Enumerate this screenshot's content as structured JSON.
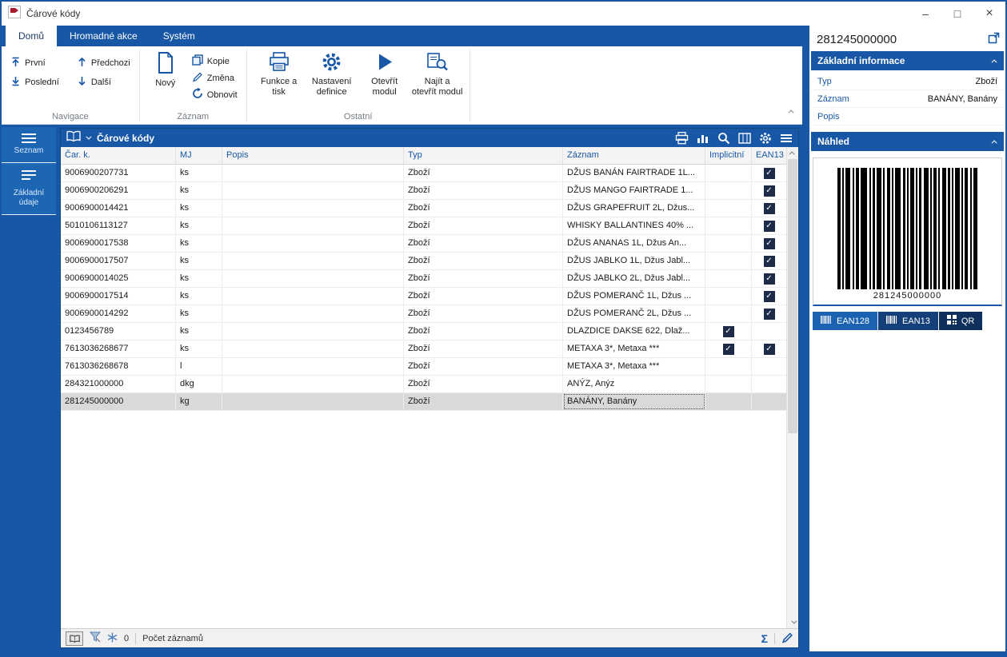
{
  "window": {
    "title": "Čárové kódy",
    "controls": {
      "minimize": "–",
      "maximize": "□",
      "close": "×"
    }
  },
  "tabs": [
    {
      "label": "Domů",
      "active": true
    },
    {
      "label": "Hromadné akce",
      "active": false
    },
    {
      "label": "Systém",
      "active": false
    }
  ],
  "ribbon": {
    "navigace": {
      "label": "Navigace",
      "prvni": "První",
      "posledni": "Poslední",
      "predchozi": "Předchozi",
      "dalsi": "Další"
    },
    "zaznam": {
      "label": "Záznam",
      "novy": "Nový",
      "kopie": "Kopie",
      "zmena": "Změna",
      "obnovit": "Obnovit"
    },
    "ostatni": {
      "label": "Ostatní",
      "funkce_tisk": "Funkce a tisk",
      "nastaveni_definice": "Nastavení definice",
      "otevrit_modul": "Otevřít modul",
      "najit_otevrit": "Najít a otevřít modul"
    }
  },
  "sidebar": {
    "items": [
      {
        "label": "Seznam"
      },
      {
        "label": "Základní údaje"
      }
    ]
  },
  "grid": {
    "title": "Čárové kódy",
    "columns": [
      "Čar. k.",
      "MJ",
      "Popis",
      "Typ",
      "Záznam",
      "Implicitní",
      "EAN13"
    ],
    "selected_index": 13,
    "rows": [
      {
        "code": "9006900207731",
        "mj": "ks",
        "popis": "",
        "typ": "Zboží",
        "zaznam": "DŽUS BANÁN FAIRTRADE 1L...",
        "implicitni": false,
        "ean13": true
      },
      {
        "code": "9006900206291",
        "mj": "ks",
        "popis": "",
        "typ": "Zboží",
        "zaznam": "DŽUS MANGO FAIRTRADE 1...",
        "implicitni": false,
        "ean13": true
      },
      {
        "code": "9006900014421",
        "mj": "ks",
        "popis": "",
        "typ": "Zboží",
        "zaznam": "DŽUS GRAPEFRUIT 2L, Džus...",
        "implicitni": false,
        "ean13": true
      },
      {
        "code": "5010106113127",
        "mj": "ks",
        "popis": "",
        "typ": "Zboží",
        "zaznam": "WHISKY BALLANTINES 40% ...",
        "implicitni": false,
        "ean13": true
      },
      {
        "code": "9006900017538",
        "mj": "ks",
        "popis": "",
        "typ": "Zboží",
        "zaznam": "DŽUS ANANAS 1L, Džus An...",
        "implicitni": false,
        "ean13": true
      },
      {
        "code": "9006900017507",
        "mj": "ks",
        "popis": "",
        "typ": "Zboží",
        "zaznam": "DŽUS JABLKO 1L, Džus Jabl...",
        "implicitni": false,
        "ean13": true
      },
      {
        "code": "9006900014025",
        "mj": "ks",
        "popis": "",
        "typ": "Zboží",
        "zaznam": "DŽUS JABLKO 2L, Džus Jabl...",
        "implicitni": false,
        "ean13": true
      },
      {
        "code": "9006900017514",
        "mj": "ks",
        "popis": "",
        "typ": "Zboží",
        "zaznam": "DŽUS POMERANČ 1L, Džus ...",
        "implicitni": false,
        "ean13": true
      },
      {
        "code": "9006900014292",
        "mj": "ks",
        "popis": "",
        "typ": "Zboží",
        "zaznam": "DŽUS POMERANČ 2L, Džus ...",
        "implicitni": false,
        "ean13": true
      },
      {
        "code": "0123456789",
        "mj": "ks",
        "popis": "",
        "typ": "Zboží",
        "zaznam": "DLAZDICE DAKSE 622, Dlaž...",
        "implicitni": true,
        "ean13": false
      },
      {
        "code": "7613036268677",
        "mj": "ks",
        "popis": "",
        "typ": "Zboží",
        "zaznam": "METAXA 3*, Metaxa ***",
        "implicitni": true,
        "ean13": true
      },
      {
        "code": "7613036268678",
        "mj": "l",
        "popis": "",
        "typ": "Zboží",
        "zaznam": "METAXA 3*, Metaxa ***",
        "implicitni": false,
        "ean13": false
      },
      {
        "code": "284321000000",
        "mj": "dkg",
        "popis": "",
        "typ": "Zboží",
        "zaznam": "ANÝZ, Anýz",
        "implicitni": false,
        "ean13": false
      },
      {
        "code": "281245000000",
        "mj": "kg",
        "popis": "",
        "typ": "Zboží",
        "zaznam": "BANÁNY, Banány",
        "implicitni": false,
        "ean13": false
      }
    ],
    "status": {
      "freeze_count": "0",
      "count_label": "Počet záznamů",
      "sum_symbol": "Σ"
    }
  },
  "detail": {
    "title": "281245000000",
    "info": {
      "title": "Základní informace",
      "fields": [
        {
          "label": "Typ",
          "value": "Zboží"
        },
        {
          "label": "Záznam",
          "value": "BANÁNY, Banány"
        },
        {
          "label": "Popis",
          "value": ""
        }
      ]
    },
    "preview": {
      "title": "Náhled",
      "barcode_text": "281245000000",
      "buttons": [
        {
          "label": "EAN128"
        },
        {
          "label": "EAN13"
        },
        {
          "label": "QR"
        }
      ]
    }
  }
}
